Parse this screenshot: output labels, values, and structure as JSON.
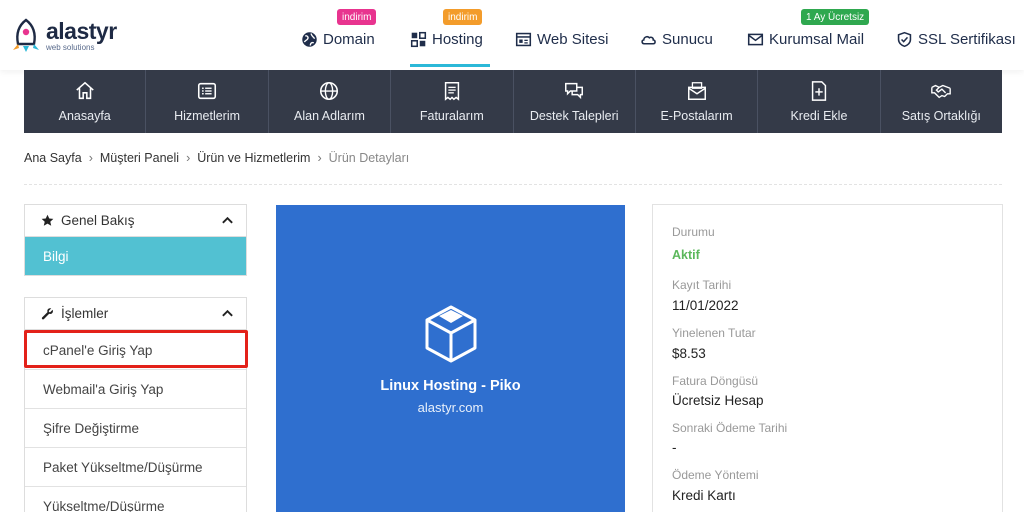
{
  "brand": {
    "name": "alastyr",
    "tagline": "web solutions"
  },
  "nav": {
    "items": [
      {
        "label": "Domain",
        "badge": "indirim",
        "icon": "globe-icon"
      },
      {
        "label": "Hosting",
        "badge": "indirim",
        "icon": "grid-icon"
      },
      {
        "label": "Web Sitesi",
        "icon": "website-icon"
      },
      {
        "label": "Sunucu",
        "icon": "cloud-icon"
      },
      {
        "label": "Kurumsal Mail",
        "badge": "1 Ay Ücretsiz",
        "icon": "mail-icon"
      },
      {
        "label": "SSL Sertifikası",
        "icon": "shield-icon"
      }
    ],
    "active": "Hosting",
    "accent": "#2bb8d8"
  },
  "menu": {
    "items": [
      {
        "label": "Anasayfa",
        "icon": "home-icon"
      },
      {
        "label": "Hizmetlerim",
        "icon": "list-icon"
      },
      {
        "label": "Alan Adlarım",
        "icon": "globe-icon"
      },
      {
        "label": "Faturalarım",
        "icon": "invoice-icon"
      },
      {
        "label": "Destek Talepleri",
        "icon": "chat-icon"
      },
      {
        "label": "E-Postalarım",
        "icon": "inbox-icon"
      },
      {
        "label": "Kredi Ekle",
        "icon": "add-file-icon"
      },
      {
        "label": "Satış Ortaklığı",
        "icon": "handshake-icon"
      }
    ]
  },
  "breadcrumb": [
    "Ana Sayfa",
    "Müşteri Paneli",
    "Ürün ve Hizmetlerim",
    "Ürün Detayları"
  ],
  "sidebar": {
    "overview": {
      "title": "Genel Bakış",
      "active_item": "Bilgi"
    },
    "actions": {
      "title": "İşlemler",
      "items": [
        "cPanel'e Giriş Yap",
        "Webmail'a Giriş Yap",
        "Şifre Değiştirme",
        "Paket Yükseltme/Düşürme",
        "Yükseltme/Düşürme"
      ]
    }
  },
  "product": {
    "name": "Linux Hosting - Piko",
    "domain": "alastyr.com",
    "color": "#2f6fcf"
  },
  "details": [
    {
      "label": "Durumu",
      "value": "Aktif",
      "status_color": "#5cb85c"
    },
    {
      "label": "Kayıt Tarihi",
      "value": "11/01/2022"
    },
    {
      "label": "Yinelenen Tutar",
      "value": "$8.53"
    },
    {
      "label": "Fatura Döngüsü",
      "value": "Ücretsiz Hesap"
    },
    {
      "label": "Sonraki Ödeme Tarihi",
      "value": "-"
    },
    {
      "label": "Ödeme Yöntemi",
      "value": "Kredi Kartı"
    }
  ]
}
